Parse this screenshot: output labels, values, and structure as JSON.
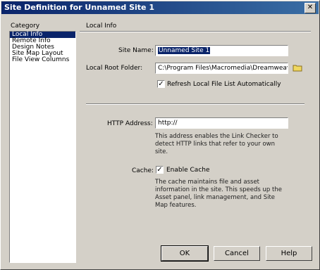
{
  "window": {
    "title": "Site Definition for Unnamed Site 1",
    "close_glyph": "✕"
  },
  "category": {
    "label": "Category",
    "items": [
      {
        "label": "Local Info"
      },
      {
        "label": "Remote Info"
      },
      {
        "label": "Design Notes"
      },
      {
        "label": "Site Map Layout"
      },
      {
        "label": "File View Columns"
      }
    ],
    "selected_index": 0
  },
  "section_title": "Local Info",
  "fields": {
    "site_name_label": "Site Name:",
    "site_name_value": "Unnamed Site 1",
    "local_root_label": "Local Root Folder:",
    "local_root_value": "C:\\Program Files\\Macromedia\\Dreamweav",
    "refresh_label": "Refresh Local File List Automatically",
    "refresh_checked": true,
    "http_label": "HTTP Address:",
    "http_value": "http://",
    "http_desc": "This address enables the Link Checker to detect HTTP links that refer to your own site.",
    "cache_label": "Cache:",
    "cache_checkbox_label": "Enable Cache",
    "cache_checked": true,
    "cache_desc": "The cache maintains file and asset information in the site.  This speeds up the Asset panel, link management, and Site Map features."
  },
  "buttons": {
    "ok": "OK",
    "cancel": "Cancel",
    "help": "Help"
  },
  "check_glyph": "✓"
}
